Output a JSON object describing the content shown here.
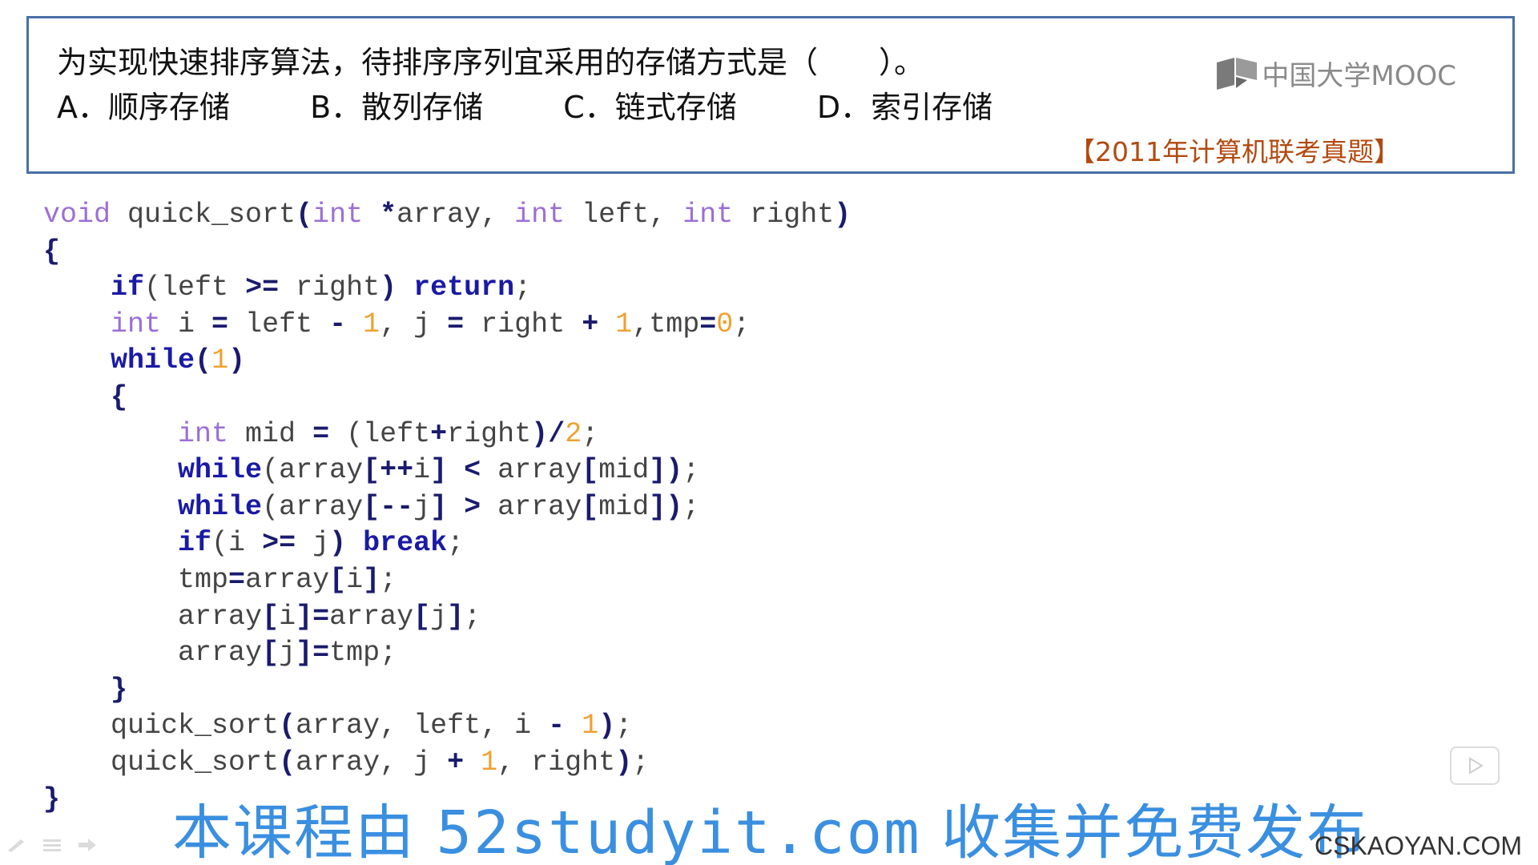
{
  "question": {
    "stem": "为实现快速排序算法，待排序序列宜采用的存储方式是（　　）。",
    "options": [
      "A．顺序存储",
      "B．散列存储",
      "C．链式存储",
      "D．索引存储"
    ],
    "source": "【2011年计算机联考真题】"
  },
  "logo": {
    "text": "中国大学MOOC"
  },
  "code": {
    "lines": [
      [
        [
          "void",
          "kw-type"
        ],
        [
          " quick_sort",
          "id"
        ],
        [
          "(",
          "op"
        ],
        [
          "int",
          "kw-type"
        ],
        [
          " ",
          "id"
        ],
        [
          "*",
          "op"
        ],
        [
          "array, ",
          "id"
        ],
        [
          "int",
          "kw-type"
        ],
        [
          " left, ",
          "id"
        ],
        [
          "int",
          "kw-type"
        ],
        [
          " right",
          "id"
        ],
        [
          ")",
          "op"
        ]
      ],
      [
        [
          "{",
          "op"
        ]
      ],
      [
        [
          "    ",
          "id"
        ],
        [
          "if",
          "kw-ctrl"
        ],
        [
          "(left ",
          "id"
        ],
        [
          ">=",
          "op"
        ],
        [
          " right",
          "id"
        ],
        [
          ")",
          "op"
        ],
        [
          " ",
          "id"
        ],
        [
          "return",
          "kw-ctrl"
        ],
        [
          ";",
          "id"
        ]
      ],
      [
        [
          "    ",
          "id"
        ],
        [
          "int",
          "kw-type"
        ],
        [
          " i ",
          "id"
        ],
        [
          "=",
          "op"
        ],
        [
          " left ",
          "id"
        ],
        [
          "-",
          "op"
        ],
        [
          " ",
          "id"
        ],
        [
          "1",
          "num"
        ],
        [
          ", j ",
          "id"
        ],
        [
          "=",
          "op"
        ],
        [
          " right ",
          "id"
        ],
        [
          "+",
          "op"
        ],
        [
          " ",
          "id"
        ],
        [
          "1",
          "num"
        ],
        [
          ",tmp",
          "id"
        ],
        [
          "=",
          "op"
        ],
        [
          "0",
          "num"
        ],
        [
          ";",
          "id"
        ]
      ],
      [
        [
          "    ",
          "id"
        ],
        [
          "while",
          "kw-ctrl"
        ],
        [
          "(",
          "op"
        ],
        [
          "1",
          "num"
        ],
        [
          ")",
          "op"
        ]
      ],
      [
        [
          "    ",
          "id"
        ],
        [
          "{",
          "op"
        ]
      ],
      [
        [
          "        ",
          "id"
        ],
        [
          "int",
          "kw-type"
        ],
        [
          " mid ",
          "id"
        ],
        [
          "=",
          "op"
        ],
        [
          " (left",
          "id"
        ],
        [
          "+",
          "op"
        ],
        [
          "right",
          "id"
        ],
        [
          ")",
          "op"
        ],
        [
          "/",
          "op"
        ],
        [
          "2",
          "num"
        ],
        [
          ";",
          "id"
        ]
      ],
      [
        [
          "        ",
          "id"
        ],
        [
          "while",
          "kw-ctrl"
        ],
        [
          "(array",
          "id"
        ],
        [
          "[++",
          "op"
        ],
        [
          "i",
          "id"
        ],
        [
          "]",
          "op"
        ],
        [
          " ",
          "id"
        ],
        [
          "<",
          "op"
        ],
        [
          " array",
          "id"
        ],
        [
          "[",
          "op"
        ],
        [
          "mid",
          "id"
        ],
        [
          "])",
          "op"
        ],
        [
          ";",
          "id"
        ]
      ],
      [
        [
          "        ",
          "id"
        ],
        [
          "while",
          "kw-ctrl"
        ],
        [
          "(array",
          "id"
        ],
        [
          "[--",
          "op"
        ],
        [
          "j",
          "id"
        ],
        [
          "]",
          "op"
        ],
        [
          " ",
          "id"
        ],
        [
          ">",
          "op"
        ],
        [
          " array",
          "id"
        ],
        [
          "[",
          "op"
        ],
        [
          "mid",
          "id"
        ],
        [
          "])",
          "op"
        ],
        [
          ";",
          "id"
        ]
      ],
      [
        [
          "        ",
          "id"
        ],
        [
          "if",
          "kw-ctrl"
        ],
        [
          "(i ",
          "id"
        ],
        [
          ">=",
          "op"
        ],
        [
          " j",
          "id"
        ],
        [
          ")",
          "op"
        ],
        [
          " ",
          "id"
        ],
        [
          "break",
          "kw-ctrl"
        ],
        [
          ";",
          "id"
        ]
      ],
      [
        [
          "        ",
          "id"
        ],
        [
          "tmp",
          "id"
        ],
        [
          "=",
          "op"
        ],
        [
          "array",
          "id"
        ],
        [
          "[",
          "op"
        ],
        [
          "i",
          "id"
        ],
        [
          "]",
          "op"
        ],
        [
          ";",
          "id"
        ]
      ],
      [
        [
          "        ",
          "id"
        ],
        [
          "array",
          "id"
        ],
        [
          "[",
          "op"
        ],
        [
          "i",
          "id"
        ],
        [
          "]=",
          "op"
        ],
        [
          "array",
          "id"
        ],
        [
          "[",
          "op"
        ],
        [
          "j",
          "id"
        ],
        [
          "]",
          "op"
        ],
        [
          ";",
          "id"
        ]
      ],
      [
        [
          "        ",
          "id"
        ],
        [
          "array",
          "id"
        ],
        [
          "[",
          "op"
        ],
        [
          "j",
          "id"
        ],
        [
          "]=",
          "op"
        ],
        [
          "tmp",
          "id"
        ],
        [
          ";",
          "id"
        ]
      ],
      [
        [
          "    ",
          "id"
        ],
        [
          "}",
          "op"
        ]
      ],
      [
        [
          "    ",
          "id"
        ],
        [
          "quick_sort",
          "id"
        ],
        [
          "(",
          "op"
        ],
        [
          "array, left, i ",
          "id"
        ],
        [
          "-",
          "op"
        ],
        [
          " ",
          "id"
        ],
        [
          "1",
          "num"
        ],
        [
          ")",
          "op"
        ],
        [
          ";",
          "id"
        ]
      ],
      [
        [
          "    ",
          "id"
        ],
        [
          "quick_sort",
          "id"
        ],
        [
          "(",
          "op"
        ],
        [
          "array, j ",
          "id"
        ],
        [
          "+",
          "op"
        ],
        [
          " ",
          "id"
        ],
        [
          "1",
          "num"
        ],
        [
          ", right",
          "id"
        ],
        [
          ")",
          "op"
        ],
        [
          ";",
          "id"
        ]
      ],
      [
        [
          "}",
          "op"
        ]
      ]
    ]
  },
  "watermark": {
    "prefix": "本课程由 ",
    "site": "52studyit.com",
    "suffix": " 收集并免费发布"
  },
  "site_watermark": "CSKAOYAN.COM",
  "icons": {
    "play": "play-icon",
    "pen": "pen-icon",
    "menu": "menu-icon",
    "next": "arrow-right-icon",
    "logo": "book-icon"
  }
}
